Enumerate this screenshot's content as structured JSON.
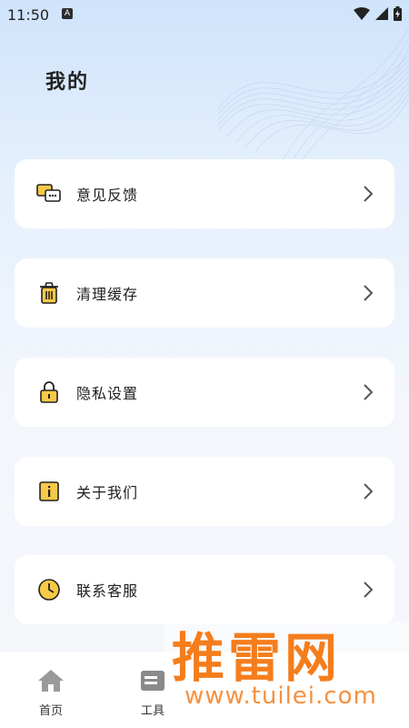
{
  "status_bar": {
    "time": "11:50",
    "notification_badge": "A"
  },
  "header": {
    "title": "我的"
  },
  "menu": {
    "items": [
      {
        "label": "意见反馈",
        "icon": "feedback-chat-icon"
      },
      {
        "label": "清理缓存",
        "icon": "trash-icon"
      },
      {
        "label": "隐私设置",
        "icon": "lock-icon"
      },
      {
        "label": "关于我们",
        "icon": "info-icon"
      },
      {
        "label": "联系客服",
        "icon": "clock-icon"
      }
    ]
  },
  "bottom_nav": {
    "items": [
      {
        "label": "首页",
        "icon": "home-icon"
      },
      {
        "label": "工具",
        "icon": "tools-icon"
      }
    ]
  },
  "watermark": {
    "brand": "推雷网",
    "url": "www.tuilei.com"
  },
  "colors": {
    "accent_yellow": "#f7c948",
    "watermark_orange": "#f57d1c",
    "card_bg": "#ffffff",
    "text_primary": "#1e1e1e"
  }
}
